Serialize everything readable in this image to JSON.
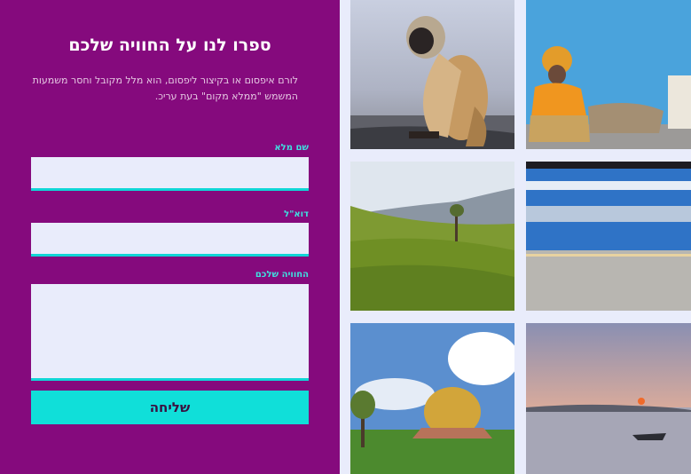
{
  "form": {
    "title": "ספרו לנו על החוויה שלכם",
    "description": "לורם איפסום או בקיצור ליפסום, הוא מלל מקובל וחסר משמעות המשמש \"ממלא מקום\" בעת עריכ.",
    "name_label": "שם מלא",
    "name_value": "",
    "email_label": "דוא\"ל",
    "email_value": "",
    "experience_label": "החוויה שלכם",
    "experience_value": "",
    "submit_label": "שליחה"
  },
  "colors": {
    "panel": "#850a7d",
    "accent": "#10dfd9",
    "page_background": "#e9ecfb"
  },
  "gallery": {
    "photos": [
      {
        "icon": "monkey-photo"
      },
      {
        "icon": "sadhu-photo"
      },
      {
        "icon": "tea-plantation-photo"
      },
      {
        "icon": "train-photo"
      },
      {
        "icon": "golden-dome-photo"
      },
      {
        "icon": "sunset-lake-photo"
      }
    ]
  }
}
